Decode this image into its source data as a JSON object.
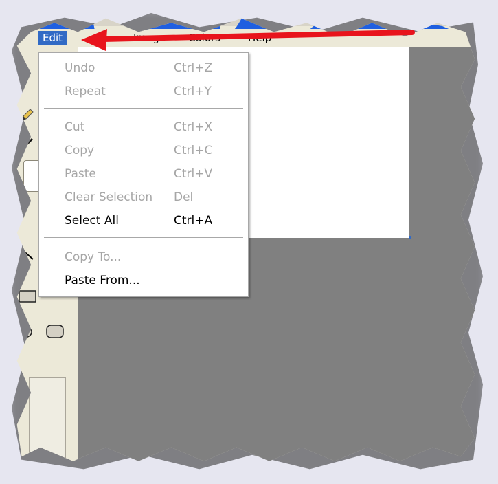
{
  "menubar": {
    "items": [
      {
        "label": "Edit",
        "active": true
      },
      {
        "label": "View",
        "visible_fragment": "w"
      },
      {
        "label": "Image"
      },
      {
        "label": "Colors"
      },
      {
        "label": "Help"
      }
    ]
  },
  "edit_menu": {
    "items": [
      {
        "label": "Undo",
        "shortcut": "Ctrl+Z",
        "enabled": false
      },
      {
        "label": "Repeat",
        "shortcut": "Ctrl+Y",
        "enabled": false
      },
      {
        "label": "Cut",
        "shortcut": "Ctrl+X",
        "enabled": false
      },
      {
        "label": "Copy",
        "shortcut": "Ctrl+C",
        "enabled": false
      },
      {
        "label": "Paste",
        "shortcut": "Ctrl+V",
        "enabled": false
      },
      {
        "label": "Clear Selection",
        "shortcut": "Del",
        "enabled": false
      },
      {
        "label": "Select All",
        "shortcut": "Ctrl+A",
        "enabled": true
      },
      {
        "label": "Copy To...",
        "shortcut": "",
        "enabled": false
      },
      {
        "label": "Paste From...",
        "shortcut": "",
        "enabled": true
      }
    ]
  },
  "toolbox": {
    "tools": [
      "pencil-icon",
      "color-picker-icon",
      "magnifier-icon",
      "line-icon",
      "rectangle-icon",
      "ellipse-icon",
      "rounded-rectangle-icon"
    ]
  },
  "colors": {
    "menu_highlight": "#316ac5",
    "arrow": "#e8141c",
    "canvas_background": "#808080",
    "waveform": "#1f5fe0",
    "disabled_text": "#a6a6a6"
  }
}
